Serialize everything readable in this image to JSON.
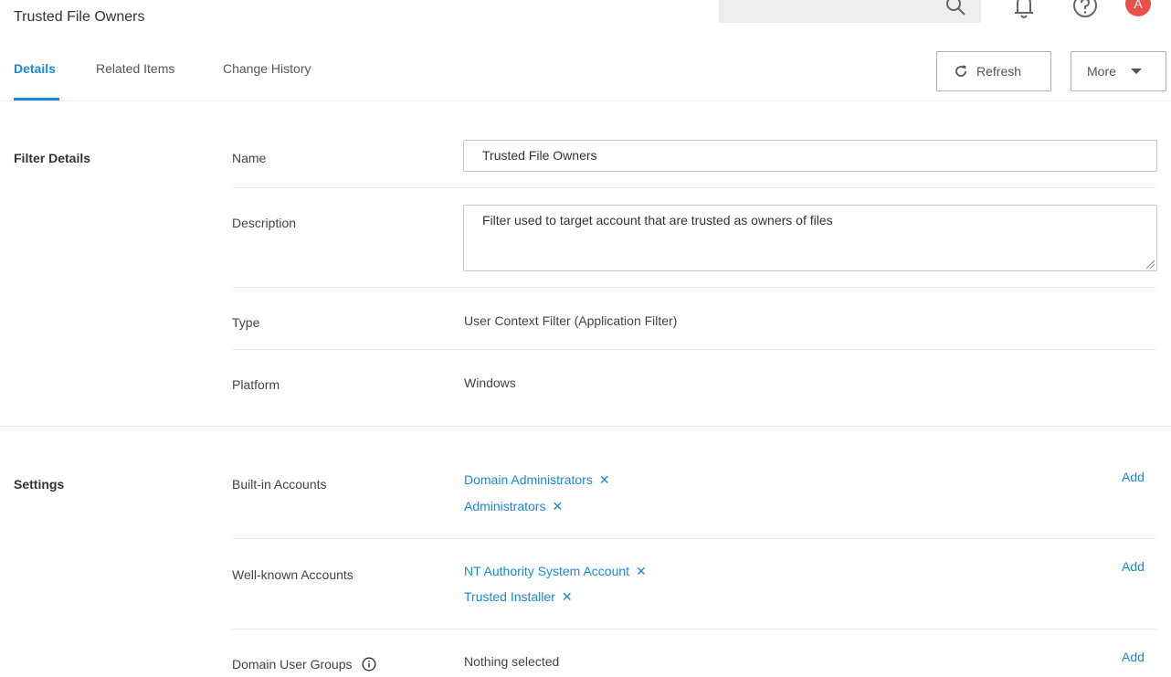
{
  "header": {
    "title": "Trusted File Owners",
    "avatar_initial": "A",
    "avatar_color": "#e8504a",
    "icons": [
      "search-icon",
      "bell-icon",
      "help-icon"
    ]
  },
  "tabs": [
    {
      "label": "Details",
      "active": true
    },
    {
      "label": "Related Items",
      "active": false
    },
    {
      "label": "Change History",
      "active": false
    }
  ],
  "toolbar": {
    "refresh_label": "Refresh",
    "more_label": "More"
  },
  "filter_details": {
    "section_title": "Filter Details",
    "name_label": "Name",
    "name_value": "Trusted File Owners",
    "description_label": "Description",
    "description_value": "Filter used to target account that are trusted as owners of files",
    "type_label": "Type",
    "type_value": "User Context Filter (Application Filter)",
    "platform_label": "Platform",
    "platform_value": "Windows"
  },
  "settings": {
    "section_title": "Settings",
    "add_label": "Add",
    "builtin_label": "Built-in Accounts",
    "builtin_items": [
      "Domain Administrators",
      "Administrators"
    ],
    "wellknown_label": "Well-known Accounts",
    "wellknown_items": [
      "NT Authority System Account",
      "Trusted Installer"
    ],
    "domain_groups_label": "Domain User Groups",
    "domain_groups_value": "Nothing selected"
  },
  "colors": {
    "accent": "#1a88d8",
    "text": "#333333"
  }
}
